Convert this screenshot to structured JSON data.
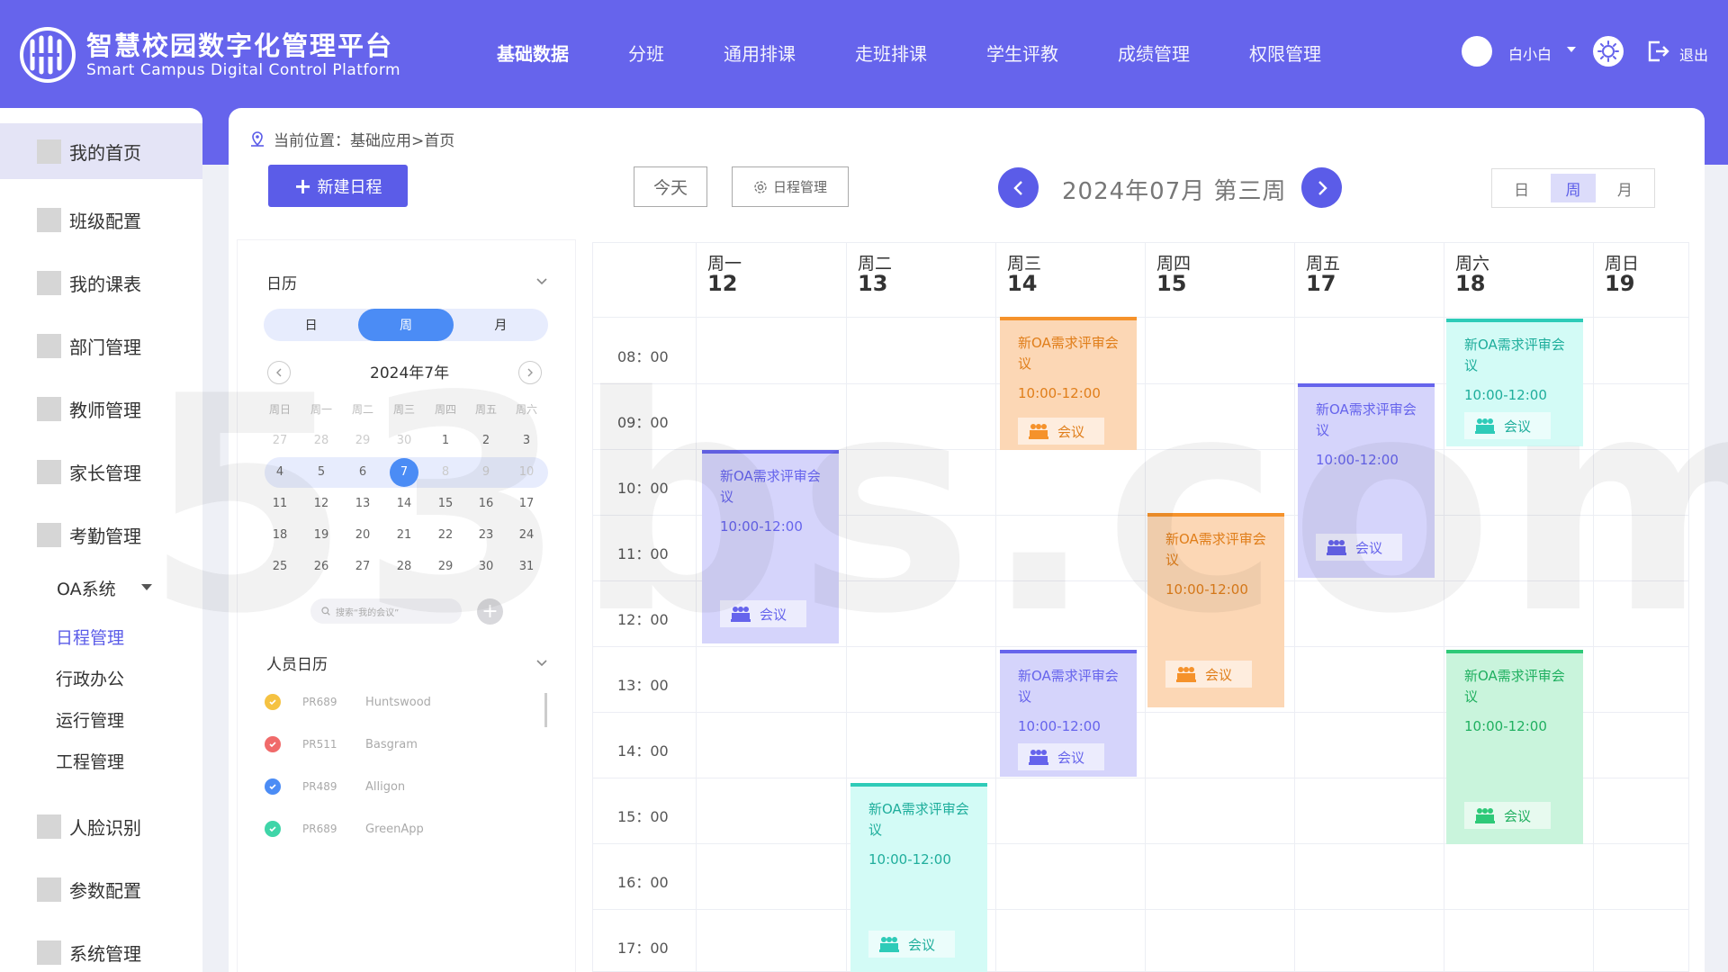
{
  "header": {
    "brand_cn": "智慧校园数字化管理平台",
    "brand_en": "Smart Campus Digital Control Platform",
    "nav": [
      "基础数据",
      "分班",
      "通用排课",
      "走班排课",
      "学生评教",
      "成绩管理",
      "权限管理"
    ],
    "user_name": "白小白",
    "logout": "退出"
  },
  "sidebar": {
    "items": [
      "我的首页",
      "班级配置",
      "我的课表",
      "部门管理",
      "教师管理",
      "家长管理",
      "考勤管理"
    ],
    "group": "OA系统",
    "sub_items": [
      "日程管理",
      "行政办公",
      "运行管理",
      "工程管理"
    ],
    "items_bottom": [
      "人脸识别",
      "参数配置",
      "系统管理"
    ]
  },
  "breadcrumb": "当前位置：基础应用>首页",
  "toolbar": {
    "new_label": "新建日程",
    "today_label": "今天",
    "manage_label": "日程管理",
    "week_title": "2024年07月 第三周",
    "views": [
      "日",
      "周",
      "月"
    ],
    "active_view": "周"
  },
  "mini": {
    "title": "日历",
    "tabs": [
      "日",
      "周",
      "月"
    ],
    "month": "2024年7年",
    "weekdays": [
      "周日",
      "周一",
      "周二",
      "周三",
      "周四",
      "周五",
      "周六"
    ],
    "rows": [
      [
        "27",
        "28",
        "29",
        "30",
        "1",
        "2",
        "3"
      ],
      [
        "4",
        "5",
        "6",
        "7",
        "8",
        "9",
        "10"
      ],
      [
        "11",
        "12",
        "13",
        "14",
        "15",
        "16",
        "17"
      ],
      [
        "18",
        "19",
        "20",
        "21",
        "22",
        "23",
        "24"
      ],
      [
        "25",
        "26",
        "27",
        "28",
        "29",
        "30",
        "31"
      ]
    ],
    "selected": "7",
    "search_placeholder": "搜索“我的会议”",
    "people_title": "人员日历",
    "people": [
      {
        "code": "PR689",
        "name": "Huntswood",
        "color": "#f5c242"
      },
      {
        "code": "PR511",
        "name": "Basgram",
        "color": "#f06a6a"
      },
      {
        "code": "PR489",
        "name": "Alligon",
        "color": "#4b8cf5"
      },
      {
        "code": "PR689",
        "name": "GreenApp",
        "color": "#3fd5a8"
      }
    ]
  },
  "week": {
    "days": [
      {
        "wd": "周一",
        "num": "12"
      },
      {
        "wd": "周二",
        "num": "13"
      },
      {
        "wd": "周三",
        "num": "14"
      },
      {
        "wd": "周四",
        "num": "15"
      },
      {
        "wd": "周五",
        "num": "17"
      },
      {
        "wd": "周六",
        "num": "18"
      },
      {
        "wd": "周日",
        "num": "19"
      }
    ],
    "times": [
      "08：00",
      "09：00",
      "10：00",
      "11：00",
      "12：00",
      "13：00",
      "14：00",
      "15：00",
      "16：00",
      "17：00"
    ]
  },
  "event_text": {
    "title": "新OA需求评审会议",
    "time": "10:00-12:00",
    "tag": "会议"
  },
  "watermark": "53bs.com"
}
